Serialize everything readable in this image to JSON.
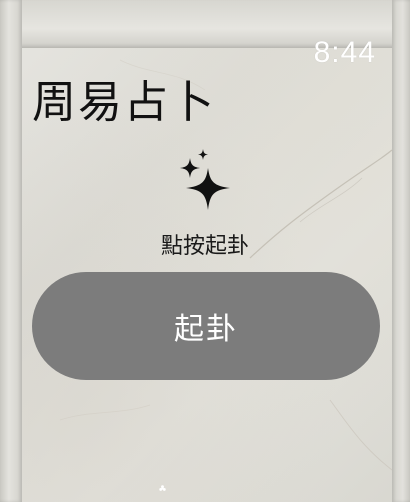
{
  "status_bar": {
    "time": "8:44"
  },
  "header": {
    "title": "周易占卜"
  },
  "main": {
    "icon": "sparkles-icon",
    "hint": "點按起卦",
    "cast_button_label": "起卦"
  },
  "colors": {
    "button_background": "#7c7c7c",
    "button_text": "#ffffff",
    "time_text": "#ffffff",
    "title_text": "#111111"
  }
}
